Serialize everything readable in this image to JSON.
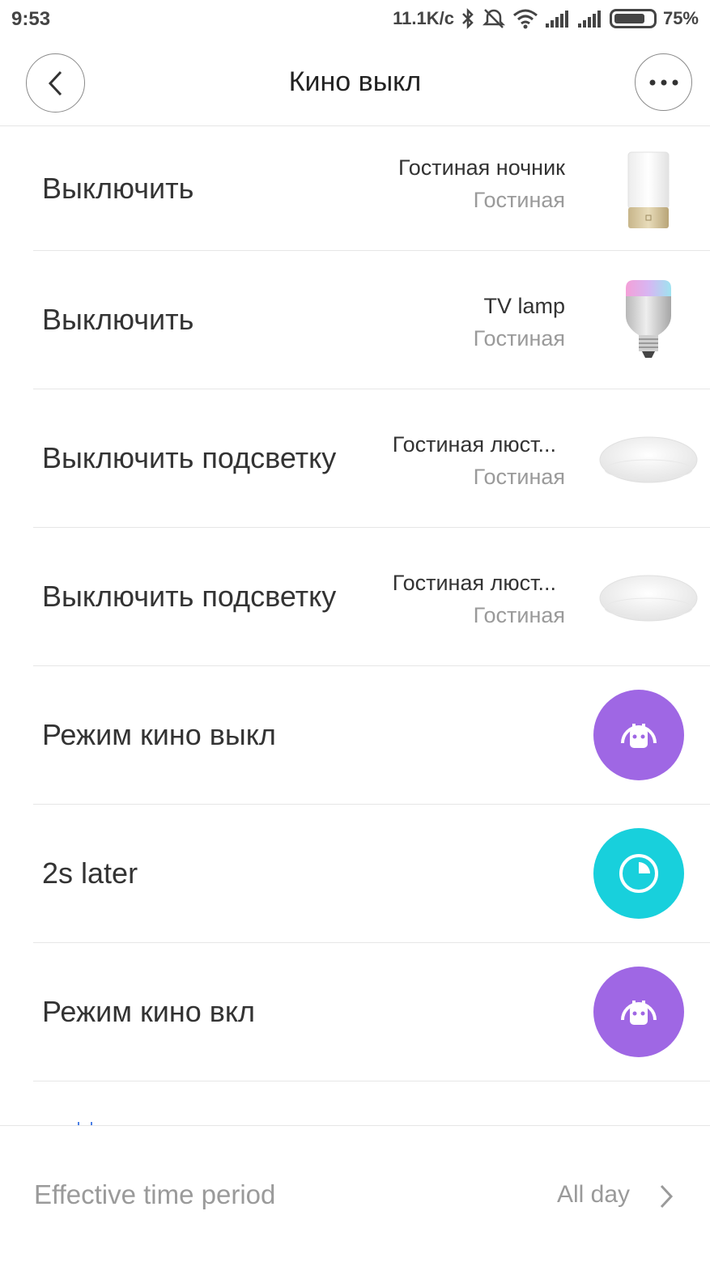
{
  "status_bar": {
    "time": "9:53",
    "network_speed": "11.1K/c",
    "battery_percent": "75%",
    "battery_level": 0.75,
    "icons": [
      "bluetooth-icon",
      "alarm-off-icon",
      "wifi-icon",
      "signal-icon",
      "signal-icon",
      "battery-icon"
    ]
  },
  "header": {
    "title": "Кино выкл",
    "back_icon": "chevron-left-icon",
    "more_icon": "more-dots-icon"
  },
  "actions": [
    {
      "label": "Выключить",
      "device_name": "Гостиная ночник",
      "room": "Гостиная",
      "thumbnail": "bedside-lamp"
    },
    {
      "label": "Выключить",
      "device_name": "TV lamp",
      "room": "Гостиная",
      "thumbnail": "color-bulb"
    },
    {
      "label": "Выключить подсветку",
      "device_name": "Гостиная люст...",
      "room": "Гостиная",
      "thumbnail": "ceiling-light"
    },
    {
      "label": "Выключить подсветку",
      "device_name": "Гостиная люст...",
      "room": "Гостиная",
      "thumbnail": "ceiling-light"
    },
    {
      "label": "Режим кино выкл",
      "icon": "scene-robot-icon",
      "icon_color": "#9f67e4"
    },
    {
      "label": "2s later",
      "icon": "timer-icon",
      "icon_color": "#18d0dc"
    },
    {
      "label": "Режим кино вкл",
      "icon": "scene-robot-icon",
      "icon_color": "#9f67e4"
    }
  ],
  "footer": {
    "label": "Effective time period",
    "value": "All day",
    "chevron_icon": "chevron-right-icon"
  }
}
